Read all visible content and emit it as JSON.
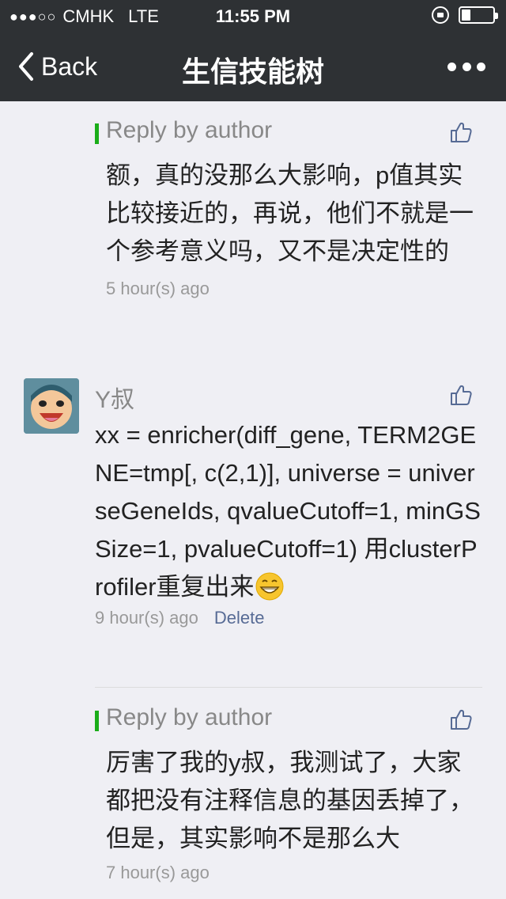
{
  "status_bar": {
    "signal": "●●●○○",
    "carrier": "CMHK",
    "network": "LTE",
    "time": "11:55 PM",
    "battery_level": 0.3
  },
  "nav": {
    "back_label": "Back",
    "title": "生信技能树"
  },
  "reply1": {
    "label": "Reply by author",
    "text": "额，真的没那么大影响，p值其实比较接近的，再说，他们不就是一个参考意义吗，又不是决定性的",
    "time": "5 hour(s) ago"
  },
  "comment": {
    "user": "Y叔",
    "text": "xx = enricher(diff_gene, TERM2GENE=tmp[, c(2,1)], universe = universeGeneIds, qvalueCutoff=1, minGSSize=1, pvalueCutoff=1) 用clusterProfiler重复出来",
    "emoji_icon": "grinning-emoji-icon",
    "time": "9 hour(s) ago",
    "delete_label": "Delete"
  },
  "reply2": {
    "label": "Reply by author",
    "text": "厉害了我的y叔，我测试了，大家都把没有注释信息的基因丢掉了，但是，其实影响不是那么大",
    "time": "7 hour(s) ago"
  },
  "colors": {
    "header_bg": "#2e3134",
    "page_bg": "#efeff4",
    "reply_bar": "#1aad19",
    "link": "#576b95"
  }
}
